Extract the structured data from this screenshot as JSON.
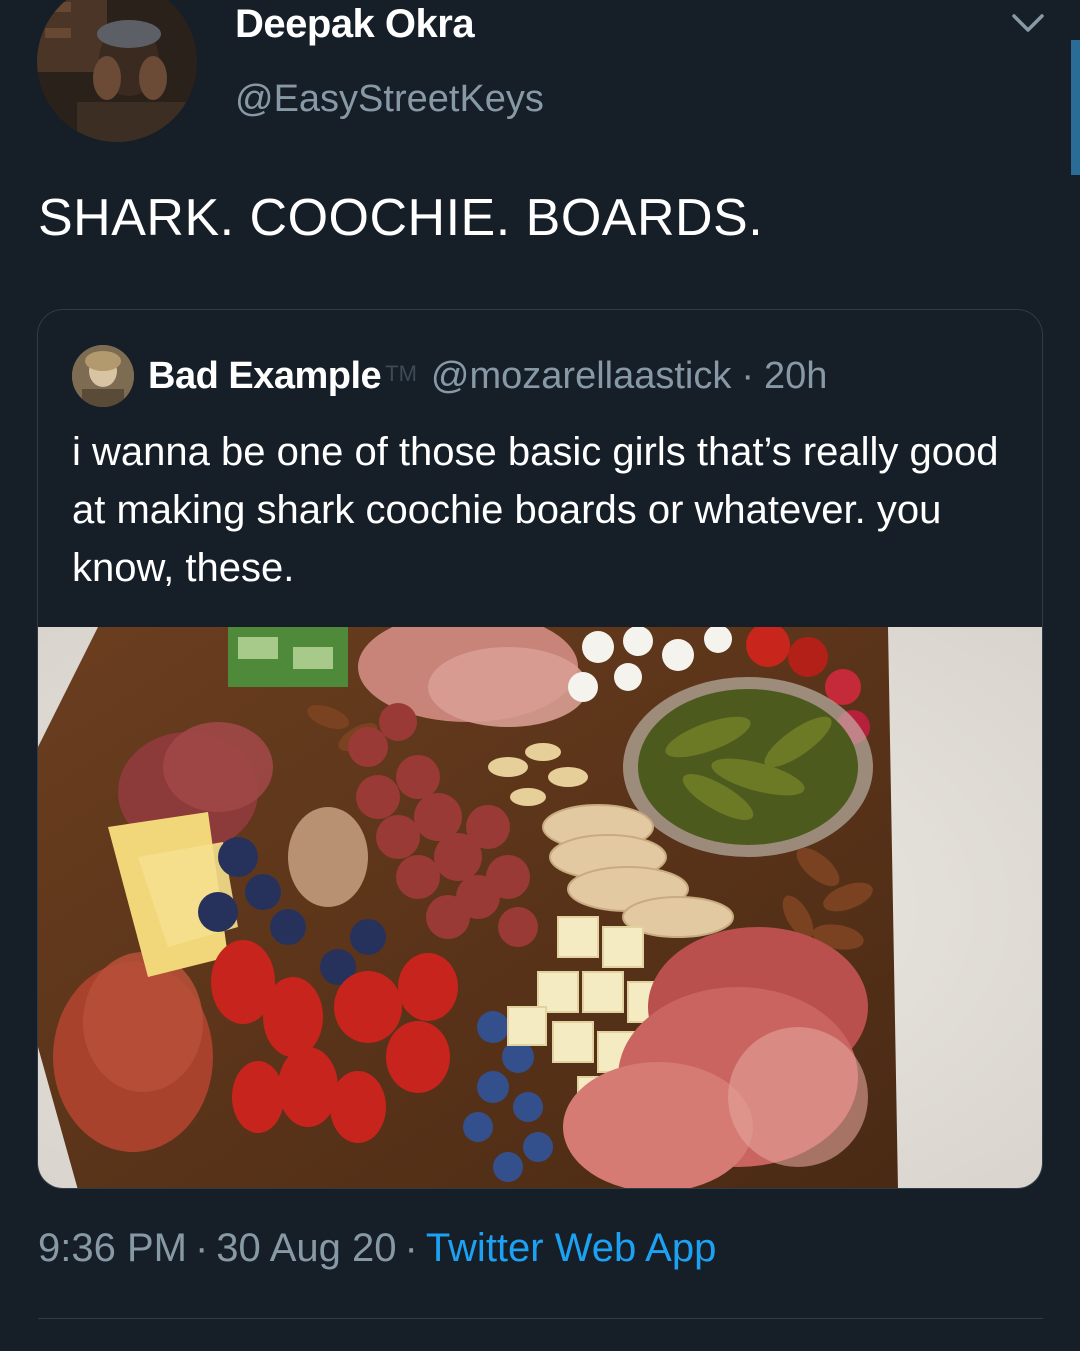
{
  "tweet": {
    "author": {
      "display_name": "Deepak Okra",
      "handle": "@EasyStreetKeys"
    },
    "text": "SHARK. COOCHIE. BOARDS.",
    "menu_icon": "chevron-down-icon",
    "quoted": {
      "display_name": "Bad Example",
      "name_suffix": "TM",
      "handle": "@mozarellaastick",
      "separator": "·",
      "time_ago": "20h",
      "text": "i wanna be one of those basic girls that’s really good at making shark coochie boards or whatever. you know, these."
    },
    "footer": {
      "time": "9:36 PM",
      "separator": "·",
      "date": "30 Aug 20",
      "source": "Twitter Web App"
    }
  },
  "colors": {
    "background": "#161e28",
    "secondary_text": "#8899a6",
    "accent": "#1da1f2",
    "border": "#2f3b47"
  }
}
